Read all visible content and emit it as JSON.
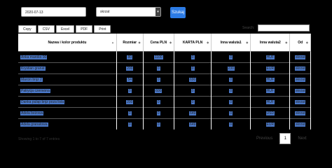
{
  "filters": {
    "date_value": "2020-07-13",
    "location_value": "skrzat",
    "submit_label": "Szukaj"
  },
  "export_buttons": [
    "Copy",
    "CSV",
    "Excel",
    "PDF",
    "Print"
  ],
  "search": {
    "label": "Search:"
  },
  "table": {
    "headers": [
      "Nazwa i kolor produktu",
      "Rozmiar",
      "Cena PLN",
      "KARTA PLN",
      "Inna waluta1",
      "Inna waluta2",
      "Od"
    ],
    "rows": [
      [
        "Anka maroko 90",
        "80",
        "1100",
        "0",
        "0",
        "HUF",
        "skrzat"
      ],
      [
        "Krystian granat",
        "200",
        "0",
        "0",
        "230",
        "EUR",
        "skrzat"
      ],
      [
        "Marcin bnjz 2",
        "54",
        "0",
        "690",
        "0",
        "HUF",
        "skrzat"
      ],
      [
        "Patrycja czerwona",
        "0",
        "600",
        "0",
        "0",
        "HUF",
        "skrzat"
      ],
      [
        "Danka pulap bnjz poza lista",
        "200",
        "0",
        "0",
        "0",
        "HUF",
        "skrzat"
      ],
      [
        "Adela beżowa",
        "0",
        "0",
        "649",
        "0",
        "USD",
        "skrzat"
      ],
      [
        "Adela granatowa",
        "0",
        "0",
        "649",
        "0",
        "EUR",
        "skrzat"
      ]
    ]
  },
  "footer": {
    "info": "Showing 1 to 7 of 7 entries",
    "prev_label": "Previous",
    "page": "1",
    "next_label": "Next"
  }
}
